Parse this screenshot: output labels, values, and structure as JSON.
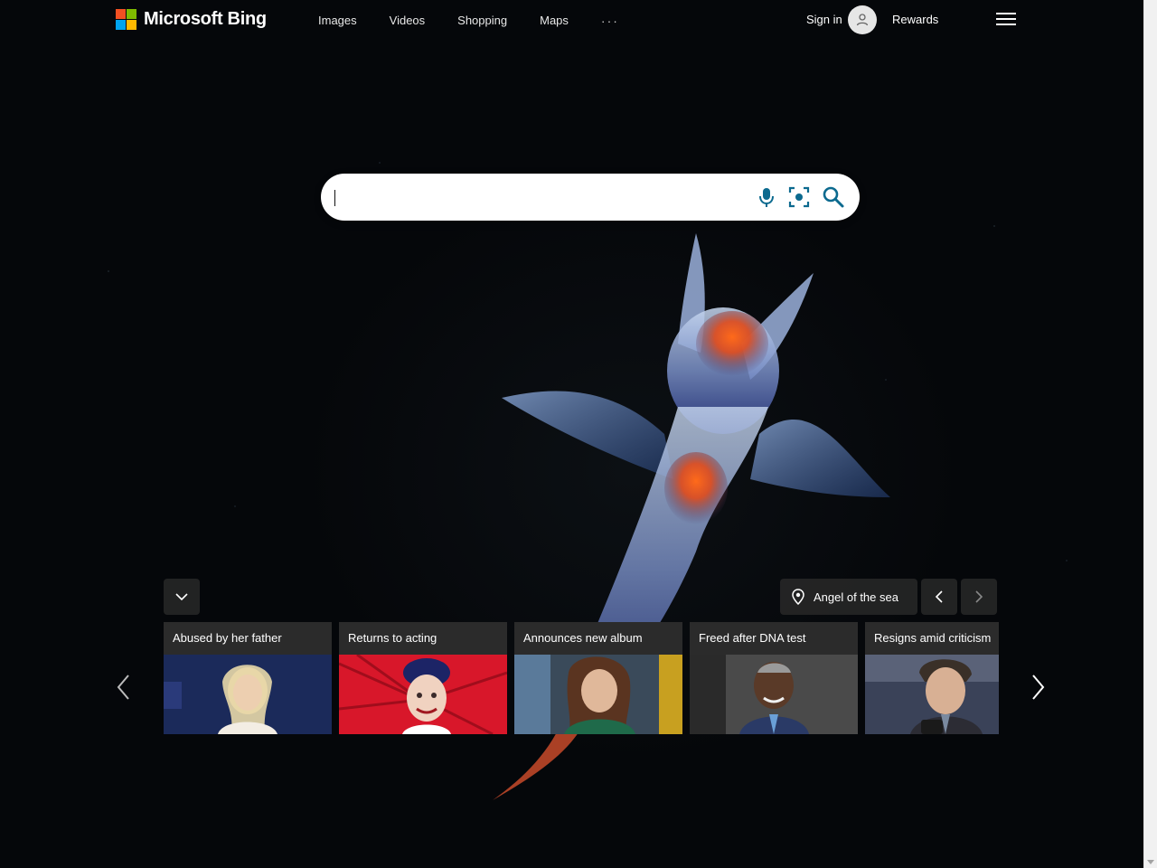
{
  "header": {
    "brand": "Microsoft Bing",
    "nav": [
      "Images",
      "Videos",
      "Shopping",
      "Maps"
    ],
    "more": "···",
    "signin": "Sign in",
    "rewards": "Rewards"
  },
  "search": {
    "value": "",
    "placeholder": ""
  },
  "image_info": {
    "title": "Angel of the sea"
  },
  "news": [
    {
      "title": "Abused by her father"
    },
    {
      "title": "Returns to acting"
    },
    {
      "title": "Announces new album"
    },
    {
      "title": "Freed after DNA test"
    },
    {
      "title": "Resigns amid criticism"
    }
  ],
  "colors": {
    "ms_red": "#f25022",
    "ms_green": "#7fba00",
    "ms_blue": "#00a4ef",
    "ms_yellow": "#ffb900",
    "search_icon": "#0c6a8f"
  },
  "icons": {
    "mic": "microphone-icon",
    "visual_search": "visual-search-icon",
    "search": "search-icon",
    "pin": "location-pin-icon",
    "menu": "hamburger-menu-icon"
  }
}
